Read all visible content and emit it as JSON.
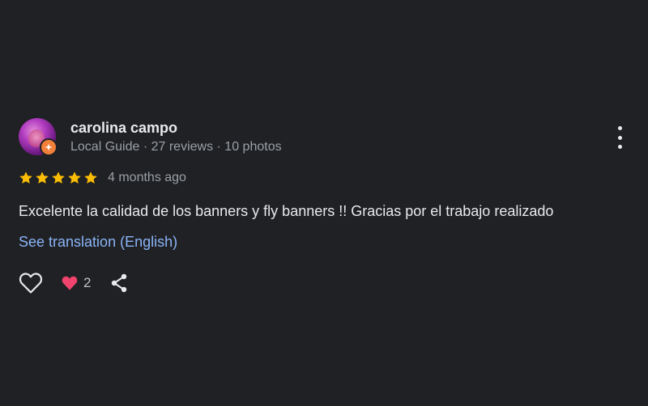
{
  "review": {
    "author": {
      "name": "carolina campo",
      "meta": "Local Guide · 27 reviews · 10 photos",
      "avatar_icon": "user-avatar",
      "badge_icon": "local-guide-badge-icon",
      "badge_color": "#f2803a"
    },
    "rating": {
      "stars": 5,
      "max": 5,
      "star_color": "#fbbc04",
      "star_icon": "star-icon"
    },
    "date": "4 months ago",
    "text": "Excelente la calidad de los banners y fly banners !! Gracias por el trabajo realizado",
    "translation_link": "See translation (English)",
    "actions": {
      "like_icon": "heart-outline-icon",
      "reaction_icon": "heart-filled-icon",
      "reaction_color": "#f0446e",
      "reaction_count": "2",
      "share_icon": "share-icon",
      "more_icon": "more-vertical-icon"
    }
  },
  "colors": {
    "background": "#202124",
    "primary_text": "#e8eaed",
    "secondary_text": "#9aa0a6",
    "link": "#8ab4f8"
  }
}
